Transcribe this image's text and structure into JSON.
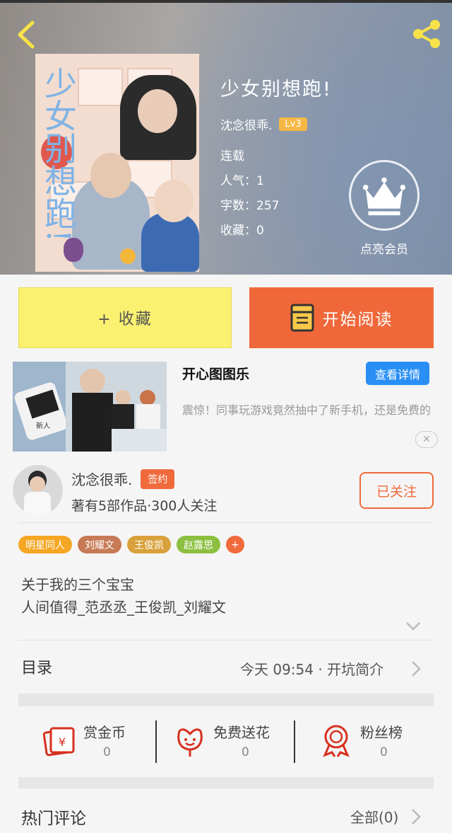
{
  "book": {
    "title": "少女别想跑!",
    "author": "沈念很乖.",
    "level": "Lv3",
    "status": "连载",
    "popularity": "人气：1",
    "word_count": "字数：257",
    "favorites": "收藏：0",
    "vip_label": "点亮会员"
  },
  "actions": {
    "collect_label": "+ 收藏",
    "read_label": "开始阅读"
  },
  "ad": {
    "title": "开心图图乐",
    "button": "查看详情",
    "description": "震惊！同事玩游戏竟然抽中了新手机，还是免费的",
    "close": "✕",
    "image_caption": "新人"
  },
  "author": {
    "name": "沈念很乖.",
    "badge": "签约",
    "stats": "著有5部作品·300人关注",
    "follow_label": "已关注"
  },
  "tags": [
    {
      "label": "明星同人",
      "color": "#f5a623"
    },
    {
      "label": "刘耀文",
      "color": "#c77a55"
    },
    {
      "label": "王俊凯",
      "color": "#d9a13b"
    },
    {
      "label": "赵露思",
      "color": "#8cbf3f"
    },
    {
      "label": "+",
      "color": "#f06a3c"
    }
  ],
  "description": {
    "line1": "关于我的三个宝宝",
    "line2": "人间值得_范丞丞_王俊凯_刘耀文"
  },
  "toc": {
    "label": "目录",
    "latest": "今天 09:54 · 开坑简介"
  },
  "stats": [
    {
      "name": "赏金币",
      "value": "0",
      "icon": "red-envelope-icon"
    },
    {
      "name": "免费送花",
      "value": "0",
      "icon": "flower-icon"
    },
    {
      "name": "粉丝榜",
      "value": "0",
      "icon": "medal-icon"
    }
  ],
  "comments": {
    "label": "热门评论",
    "all": "全部(0)"
  },
  "colors": {
    "accent": "#f06a3c",
    "collect_yellow": "#faf170",
    "ad_blue": "#2a8ff5"
  }
}
